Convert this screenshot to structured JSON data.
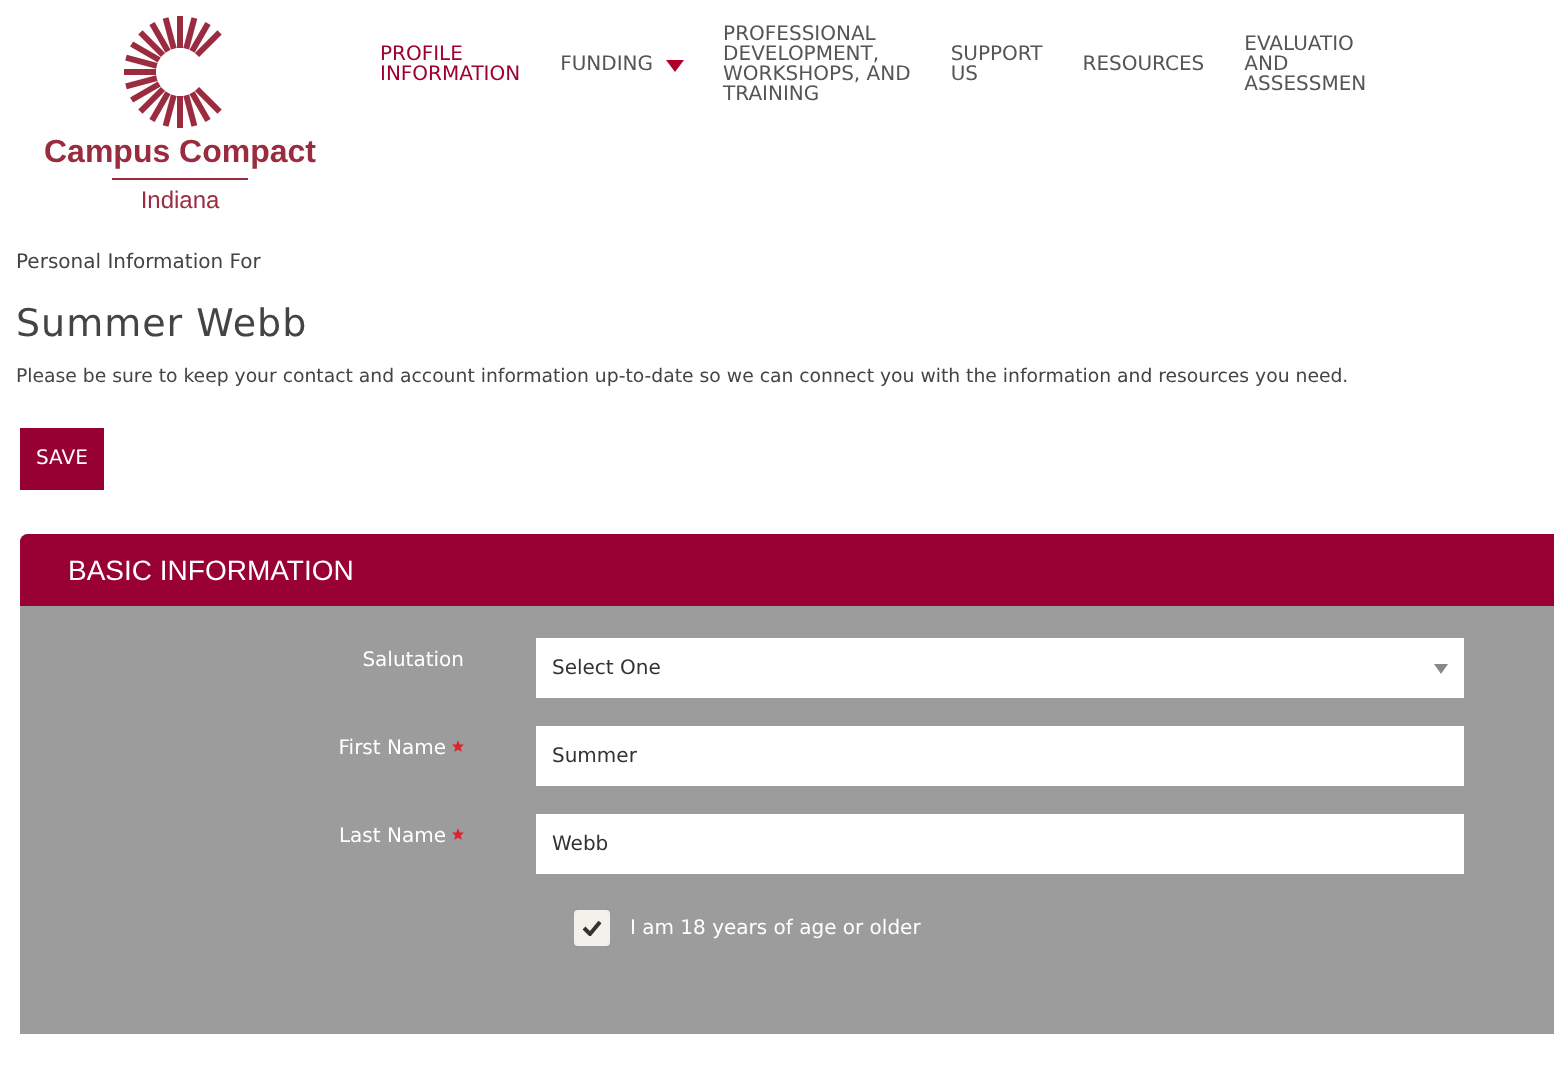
{
  "logo": {
    "name": "Campus Compact",
    "region": "Indiana"
  },
  "nav": [
    {
      "label": "PROFILE\nINFORMATION",
      "selected": true,
      "dropdown": false
    },
    {
      "label": "FUNDING",
      "selected": false,
      "dropdown": true
    },
    {
      "label": "PROFESSIONAL\nDEVELOPMENT,\nWORKSHOPS, AND\nTRAINING",
      "selected": false,
      "dropdown": false
    },
    {
      "label": "SUPPORT\nUS",
      "selected": false,
      "dropdown": false
    },
    {
      "label": "RESOURCES",
      "selected": false,
      "dropdown": false
    },
    {
      "label": "EVALUATIO\nAND\nASSESSMEN",
      "selected": false,
      "dropdown": false
    }
  ],
  "heading_prefix": "Personal Information For",
  "person_name": "Summer Webb",
  "intro": "Please be sure to keep your contact and account information up-to-date so we can connect you with the information and resources you need.",
  "save_button": "SAVE",
  "section": {
    "title": "BASIC INFORMATION",
    "fields": [
      {
        "kind": "select",
        "label": "Salutation",
        "required": false,
        "value": "Select One"
      },
      {
        "kind": "text",
        "label": "First Name",
        "required": true,
        "value": "Summer"
      },
      {
        "kind": "text",
        "label": "Last Name",
        "required": true,
        "value": "Webb"
      }
    ],
    "checkbox": {
      "label": "I am 18 years of age or older",
      "checked": true
    }
  }
}
